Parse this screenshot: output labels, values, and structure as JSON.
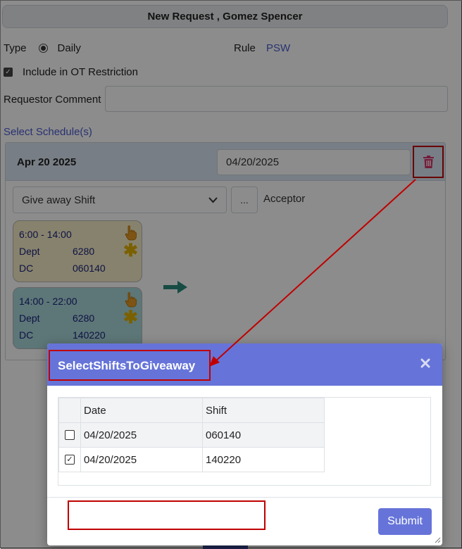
{
  "form": {
    "title": "New Request , Gomez Spencer",
    "type_label": "Type",
    "type_value": "Daily",
    "rule_label": "Rule",
    "rule_value": "PSW",
    "ot_label": "Include in OT Restriction",
    "comment_label": "Requestor Comment",
    "comment_value": "",
    "select_schedules_label": "Select Schedule(s)"
  },
  "schedule": {
    "date_title": "Apr 20 2025",
    "date_value": "04/20/2025",
    "action_value": "Give away Shift",
    "ellipsis_label": "...",
    "acceptor_label": "Acceptor",
    "shifts": [
      {
        "time": "6:00 - 14:00",
        "dept_label": "Dept",
        "dept": "6280",
        "dc_label": "DC",
        "dc": "060140",
        "color": "#f6edc6"
      },
      {
        "time": "14:00 - 22:00",
        "dept_label": "Dept",
        "dept": "6280",
        "dc_label": "DC",
        "dc": "140220",
        "color": "#a9d8d9"
      }
    ],
    "asterisk": "✱"
  },
  "modal": {
    "title": "SelectShiftsToGiveaway",
    "columns": [
      "",
      "Date",
      "Shift"
    ],
    "rows": [
      {
        "checked": false,
        "date": "04/20/2025",
        "shift": "060140"
      },
      {
        "checked": true,
        "date": "04/20/2025",
        "shift": "140220"
      }
    ],
    "check_mark": "✓",
    "submit_label": "Submit"
  },
  "colors": {
    "accent": "#6674d9",
    "annotation": "#c00000",
    "link": "#4a5bd0"
  },
  "icons": [
    "radio-icon",
    "checkbox-icon",
    "trash-icon",
    "chevron-down-icon",
    "hand-pointer-icon",
    "asterisk-icon",
    "arrow-right-icon",
    "close-icon",
    "resize-icon"
  ]
}
